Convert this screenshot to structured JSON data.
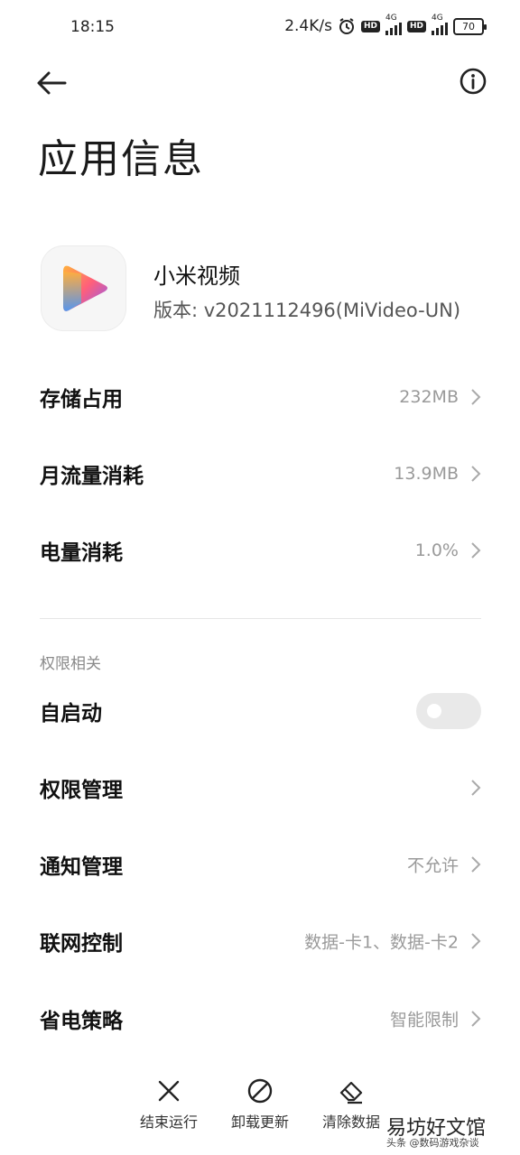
{
  "status_bar": {
    "time": "18:15",
    "net_speed": "2.4K/s",
    "hd1": "HD",
    "network1": "4G",
    "hd2": "HD",
    "network2": "4G",
    "battery": "70"
  },
  "header": {
    "back_icon": "arrow-left-icon",
    "info_icon": "info-circle-icon",
    "title": "应用信息"
  },
  "app": {
    "name": "小米视频",
    "version": "版本: v2021112496(MiVideo-UN)",
    "icon": "play-gradient-icon"
  },
  "rows_usage": [
    {
      "label": "存储占用",
      "value": "232MB"
    },
    {
      "label": "月流量消耗",
      "value": "13.9MB"
    },
    {
      "label": "电量消耗",
      "value": "1.0%"
    }
  ],
  "permissions_section": {
    "title": "权限相关",
    "autostart": {
      "label": "自启动",
      "enabled": false
    },
    "rows": [
      {
        "label": "权限管理",
        "value": ""
      },
      {
        "label": "通知管理",
        "value": "不允许"
      },
      {
        "label": "联网控制",
        "value": "数据-卡1、数据-卡2"
      },
      {
        "label": "省电策略",
        "value": "智能限制"
      }
    ]
  },
  "bottom_actions": [
    {
      "label": "结束运行",
      "icon": "close-x-icon"
    },
    {
      "label": "卸载更新",
      "icon": "prohibited-icon"
    },
    {
      "label": "清除数据",
      "icon": "eraser-icon"
    }
  ],
  "watermark": {
    "big": "易坊好文馆",
    "small": "头条 @数码游戏杂谈"
  },
  "colors": {
    "text_primary": "#111111",
    "text_secondary": "#9a9a9a",
    "toggle_off": "#e9e9e9",
    "divider": "#e6e6e6"
  }
}
